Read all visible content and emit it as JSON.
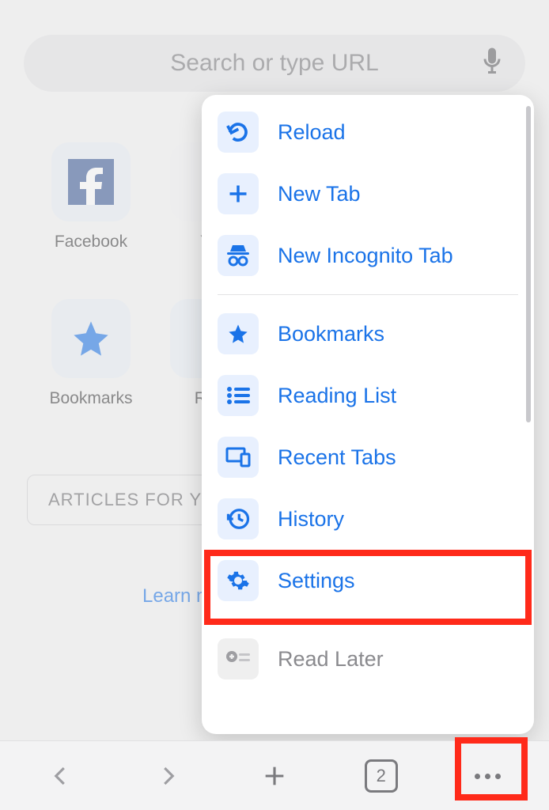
{
  "search": {
    "placeholder": "Search or type URL"
  },
  "shortcuts": [
    {
      "label": "Facebook",
      "icon": "facebook"
    },
    {
      "label": "Yo",
      "icon": "youtube-partial"
    },
    {
      "label": "Bookmarks",
      "icon": "star"
    },
    {
      "label": "Rea",
      "icon": "reading-partial"
    }
  ],
  "articles_section": "ARTICLES FOR YO",
  "learn_more": "Learn mor",
  "menu": {
    "items_top": [
      {
        "icon": "reload",
        "label": "Reload"
      },
      {
        "icon": "plus",
        "label": "New Tab"
      },
      {
        "icon": "incognito",
        "label": "New Incognito Tab"
      }
    ],
    "items_mid": [
      {
        "icon": "star",
        "label": "Bookmarks"
      },
      {
        "icon": "list",
        "label": "Reading List"
      },
      {
        "icon": "devices",
        "label": "Recent Tabs"
      },
      {
        "icon": "history",
        "label": "History"
      },
      {
        "icon": "gear",
        "label": "Settings"
      }
    ],
    "items_bottom": [
      {
        "icon": "read-later",
        "label": "Read Later",
        "muted": true
      }
    ]
  },
  "toolbar": {
    "tab_count": "2"
  }
}
